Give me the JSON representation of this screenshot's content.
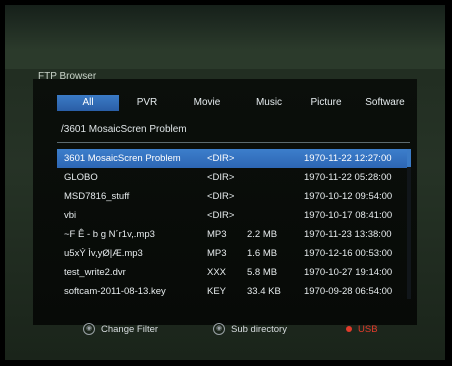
{
  "app": {
    "title": "FTP Browser"
  },
  "tabs": [
    {
      "label": "All",
      "active": true
    },
    {
      "label": "PVR"
    },
    {
      "label": "Movie"
    },
    {
      "label": "Music"
    },
    {
      "label": "Picture"
    },
    {
      "label": "Software"
    }
  ],
  "path": "/3601 MosaicScren Problem",
  "files": [
    {
      "name": "3601 MosaicScren Problem",
      "type": "<DIR>",
      "size": "",
      "date": "1970-11-22 12:27:00",
      "selected": true
    },
    {
      "name": "GLOBO",
      "type": "<DIR>",
      "size": "",
      "date": "1970-11-22 05:28:00"
    },
    {
      "name": "MSD7816_stuff",
      "type": "<DIR>",
      "size": "",
      "date": "1970-10-12 09:54:00"
    },
    {
      "name": "vbi",
      "type": "<DIR>",
      "size": "",
      "date": "1970-10-17 08:41:00"
    },
    {
      "name": "~F Ê - b g N´r1v,.mp3",
      "type": "MP3",
      "size": "2.2 MB",
      "date": "1970-11-23 13:38:00"
    },
    {
      "name": "u5xÝ Ìv,yØ|Æ.mp3",
      "type": "MP3",
      "size": "1.6 MB",
      "date": "1970-12-16 00:53:00"
    },
    {
      "name": "test_write2.dvr",
      "type": "XXX",
      "size": "5.8 MB",
      "date": "1970-10-27 19:14:00"
    },
    {
      "name": "softcam-2011-08-13.key",
      "type": "KEY",
      "size": "33.4 KB",
      "date": "1970-09-28 06:54:00"
    }
  ],
  "footer": {
    "change_filter": "Change Filter",
    "sub_directory": "Sub directory",
    "usb": "USB"
  },
  "colors": {
    "accent": "#3b7bc6",
    "usb": "#e23b2b"
  }
}
